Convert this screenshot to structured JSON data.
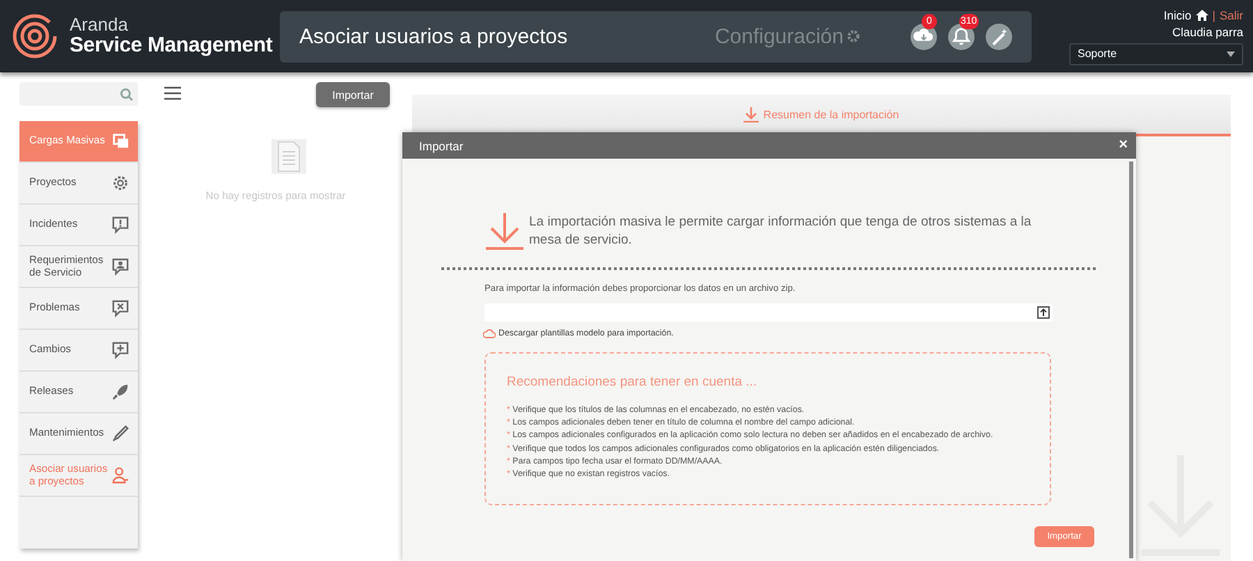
{
  "header": {
    "brand_top": "Aranda",
    "brand_bottom": "Service Management",
    "page_title": "Asociar usuarios a proyectos",
    "config_label": "Configuración",
    "badges": [
      {
        "kind": "cloud",
        "count": "0"
      },
      {
        "kind": "bell",
        "count": "310"
      },
      {
        "kind": "wand"
      }
    ],
    "home_link": "Inicio",
    "separator": "|",
    "logout_link": "Salir",
    "user_name": "Claudia parra",
    "role_select": "Soporte"
  },
  "toolbar": {
    "import_button": "Importar"
  },
  "sidebar": {
    "items": [
      {
        "label": "Cargas Masivas",
        "kind": "header",
        "selected": false
      },
      {
        "label": "Proyectos",
        "kind": "item",
        "selected": false
      },
      {
        "label": "Incidentes",
        "kind": "item",
        "selected": false
      },
      {
        "label": "Requerimientos de Servicio",
        "kind": "item",
        "selected": false
      },
      {
        "label": "Problemas",
        "kind": "item",
        "selected": false
      },
      {
        "label": "Cambios",
        "kind": "item",
        "selected": false
      },
      {
        "label": "Releases",
        "kind": "item",
        "selected": false
      },
      {
        "label": "Mantenimientos",
        "kind": "item",
        "selected": false
      },
      {
        "label": "Asociar usuarios a proyectos",
        "kind": "item",
        "selected": true
      }
    ]
  },
  "list": {
    "empty_message": "No hay registros para mostrar"
  },
  "summary_tab": {
    "label": "Resumen de la importación"
  },
  "dialog": {
    "title": "Importar",
    "close": "×",
    "intro": "La importación masiva le permite cargar información que tenga de otros sistemas a la mesa de servicio.",
    "file_label": "Para importar la información debes proporcionar los datos en un archivo zip.",
    "download_link": "Descargar plantillas modelo para importación.",
    "recommendations_title": "Recomendaciones para tener en cuenta ...",
    "bullet": "*",
    "recommendations": [
      "Verifique que los títulos de las columnas en el encabezado, no estén vacíos.",
      "Los campos adicionales deben tener en título de columna el nombre del campo adicional.",
      "Los campos adicionales configurados en la aplicación como solo lectura no deben ser añadidos en el encabezado de archivo.",
      "Verifique que todos los campos adicionales configurados como obligatorios en la aplicación estén diligenciados.",
      "Para campos tipo fecha usar el formato DD/MM/AAAA.",
      "Verifique que no existan registros vacíos."
    ],
    "import_button": "Importar"
  }
}
